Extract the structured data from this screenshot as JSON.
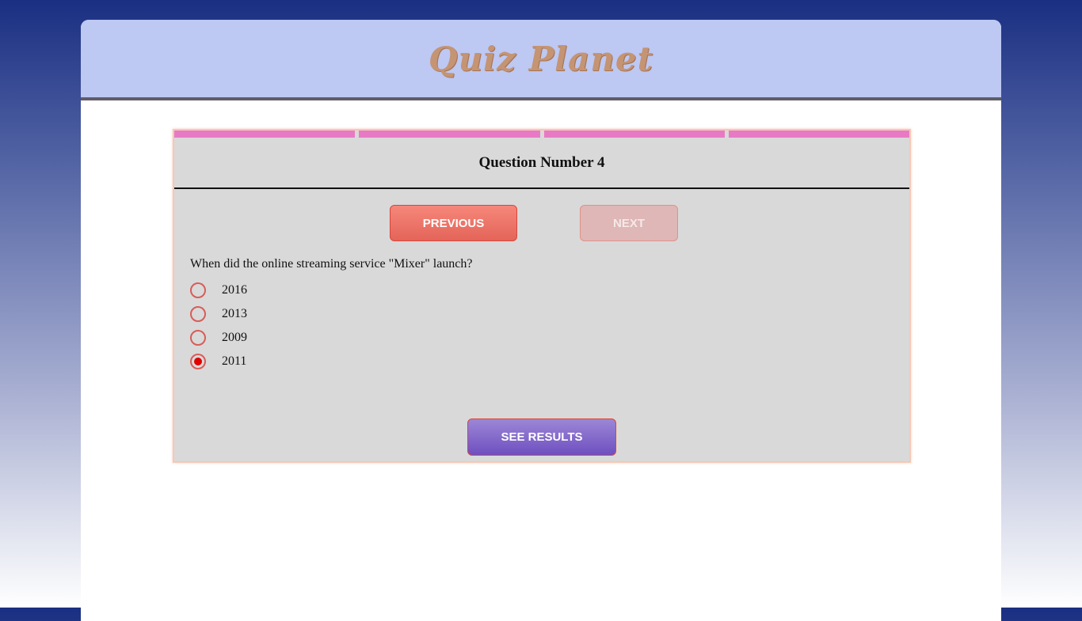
{
  "header": {
    "logo_text": "Quiz Planet"
  },
  "progress": {
    "segments": 4
  },
  "quiz": {
    "question_title": "Question Number 4",
    "previous_label": "PREVIOUS",
    "next_label": "NEXT",
    "question_text": "When did the online streaming service \"Mixer\" launch?",
    "options": [
      {
        "label": "2016",
        "selected": false
      },
      {
        "label": "2013",
        "selected": false
      },
      {
        "label": "2009",
        "selected": false
      },
      {
        "label": "2011",
        "selected": true
      }
    ],
    "results_label": "SEE RESULTS"
  },
  "colors": {
    "accent_progress": "#e87ac5",
    "prev_button": "#e46459",
    "results_button": "#6f4fc0",
    "radio_selected": "#e00000"
  }
}
